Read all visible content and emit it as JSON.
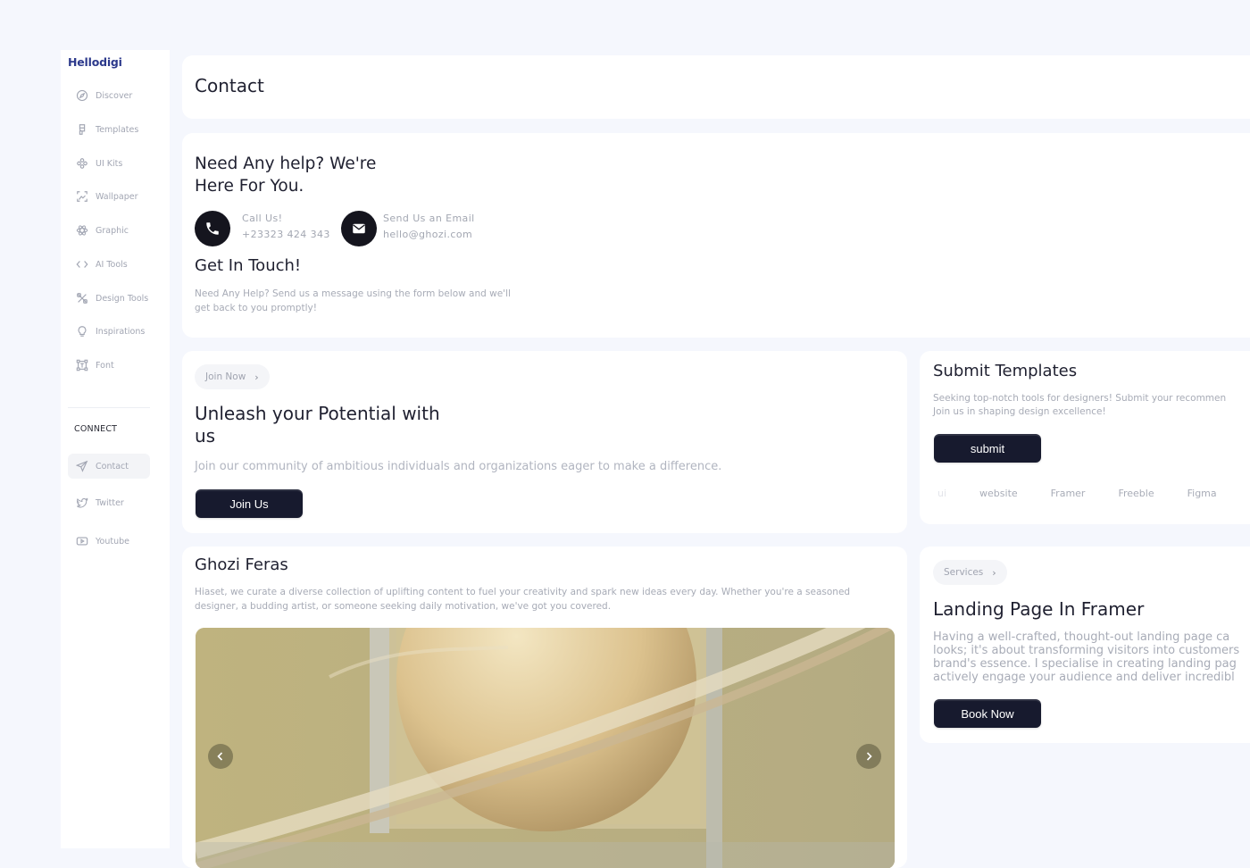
{
  "sidebar": {
    "brand": "Hellodigi",
    "items": [
      {
        "label": "Discover",
        "icon": "compass-icon"
      },
      {
        "label": "Templates",
        "icon": "figma-icon"
      },
      {
        "label": "UI Kits",
        "icon": "components-icon"
      },
      {
        "label": "Wallpaper",
        "icon": "image-icon"
      },
      {
        "label": "Graphic",
        "icon": "atom-icon"
      },
      {
        "label": "AI Tools",
        "icon": "code-icon"
      },
      {
        "label": "Design Tools",
        "icon": "tools-icon"
      },
      {
        "label": "Inspirations",
        "icon": "lightbulb-icon"
      },
      {
        "label": "Font",
        "icon": "text-frame-icon"
      }
    ],
    "connect_heading": "CONNECT",
    "connect_items": [
      {
        "label": "Contact",
        "icon": "send-icon",
        "active": true
      },
      {
        "label": "Twitter",
        "icon": "twitter-icon"
      },
      {
        "label": "Youtube",
        "icon": "youtube-icon"
      }
    ]
  },
  "header": {
    "title": "Contact"
  },
  "help": {
    "title": "Need Any help? We're Here For You.",
    "call_label": "Call Us!",
    "call_value": "+23323 424 343",
    "email_label": "Send Us an Email",
    "email_value": "hello@ghozi.com",
    "touch_title": "Get In Touch!",
    "touch_desc": "Need Any Help? Send us a message using the form below and we'll get back to you promptly!"
  },
  "join": {
    "pill": "Join Now",
    "title": "Unleash your Potential with us",
    "desc": "Join our community of ambitious individuals and organizations eager to make a difference.",
    "button": "Join Us"
  },
  "submit": {
    "title": "Submit Templates",
    "desc_line1": "Seeking top-notch tools for designers! Submit your recommen",
    "desc_line2": "Join us in shaping design excellence!",
    "button": "submit",
    "tags": [
      "ui",
      "website",
      "Framer",
      "Freeble",
      "Figma"
    ]
  },
  "ghozi": {
    "title": "Ghozi Feras",
    "desc": "Hiaset, we curate a diverse collection of uplifting content to fuel your creativity and spark new ideas every day. Whether you're a seasoned designer, a budding artist, or someone seeking daily motivation, we've got you covered."
  },
  "landing": {
    "pill": "Services",
    "title": "Landing Page In Framer",
    "desc_lines": [
      "Having a well-crafted, thought-out landing page ca",
      "looks; it's about transforming visitors into customers",
      "brand's essence. I specialise in creating landing pag",
      "actively engage your audience and deliver incredibl"
    ],
    "button": "Book Now"
  },
  "colors": {
    "accent": "#2d3a8c",
    "button": "#171a2e",
    "background": "#f5f7fd"
  }
}
